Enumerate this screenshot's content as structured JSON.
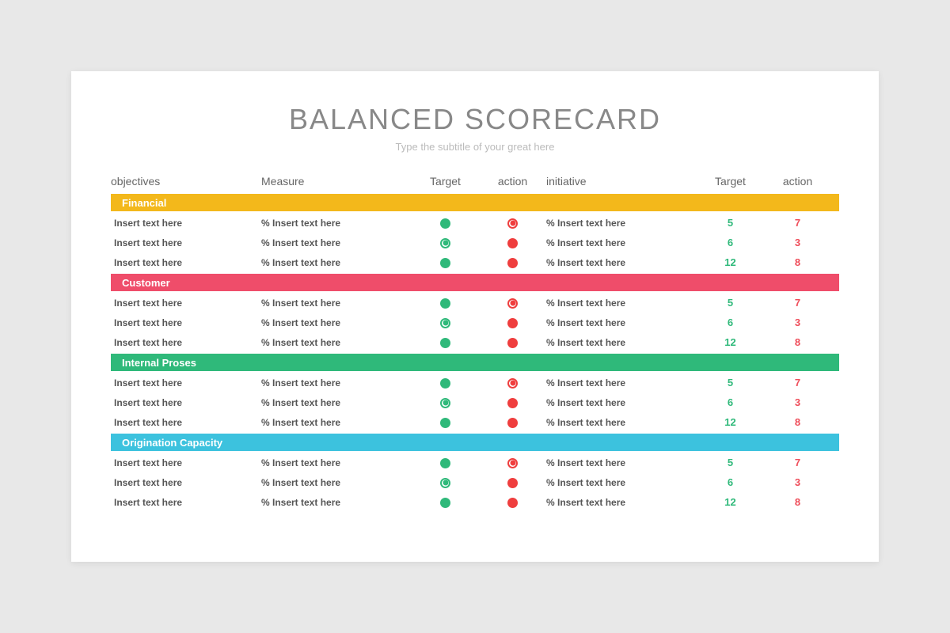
{
  "title": "BALANCED SCORECARD",
  "subtitle": "Type the subtitle of your great here",
  "headers": [
    "objectives",
    "Measure",
    "Target",
    "action",
    "initiative",
    "Target",
    "action"
  ],
  "sections": [
    {
      "label": "Financial",
      "color": "#f3b81b"
    },
    {
      "label": "Customer",
      "color": "#ef4d6a"
    },
    {
      "label": "Internal Proses",
      "color": "#2fb97a"
    },
    {
      "label": "Origination Capacity",
      "color": "#3cc2de"
    }
  ],
  "rowTemplate": [
    {
      "obj": "Insert text here",
      "measure": "% Insert text here",
      "tIcon": "dot-green",
      "aIcon": "ring-red",
      "init": "% Insert text here",
      "tNum": "5",
      "aNum": "7"
    },
    {
      "obj": "Insert text here",
      "measure": "% Insert text here",
      "tIcon": "ring-green",
      "aIcon": "dot-red",
      "init": "% Insert text here",
      "tNum": "6",
      "aNum": "3"
    },
    {
      "obj": "Insert text here",
      "measure": "% Insert text here",
      "tIcon": "dot-green",
      "aIcon": "dot-red",
      "init": "% Insert text here",
      "tNum": "12",
      "aNum": "8"
    }
  ]
}
